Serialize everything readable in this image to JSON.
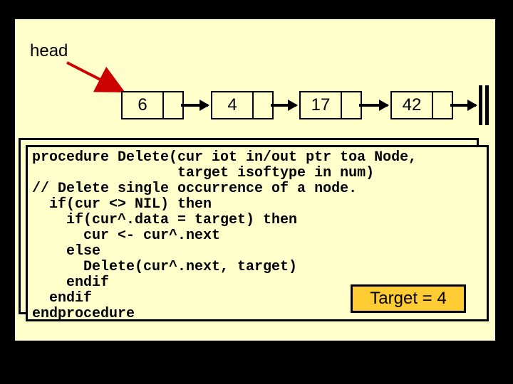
{
  "head_label": "head",
  "nodes": {
    "n1": "6",
    "n2": "4",
    "n3": "17",
    "n4": "42"
  },
  "code_lines": [
    "procedure Delete(cur iot in/out ptr toa Node,",
    "                 target isoftype in num)",
    "// Delete single occurrence of a node.",
    "  if(cur <> NIL) then",
    "    if(cur^.data = target) then",
    "      cur <- cur^.next",
    "    else",
    "      Delete(cur^.next, target)",
    "    endif",
    "  endif",
    "endprocedure"
  ],
  "target_badge": "Target = 4"
}
